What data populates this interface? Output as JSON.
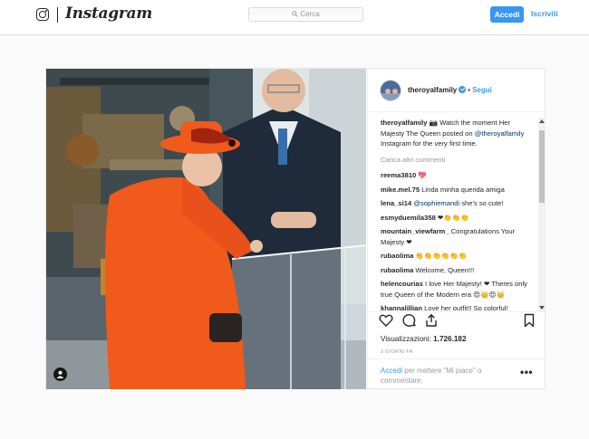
{
  "header": {
    "logo_icon": "instagram-camera-icon",
    "wordmark": "Instagram",
    "search_placeholder": "Cerca",
    "login_label": "Accedi",
    "signup_label": "Iscriviti"
  },
  "post": {
    "account": "theroyalfamily",
    "follow_label": "Segui",
    "caption_user": "theroyalfamily",
    "caption_pre": "📷 Watch the moment Her Majesty The Queen posted on ",
    "caption_mention": "@theroyalfamily",
    "caption_post": " Instagram for the very first time.",
    "load_more": "Carica altri commenti",
    "comments": [
      {
        "user": "reema3810",
        "text": "💖"
      },
      {
        "user": "mike.mel.75",
        "text": "Linda minha querida amiga"
      },
      {
        "user": "lena_si14",
        "mention": "@sophiemandi",
        "text": " she's so cute!"
      },
      {
        "user": "esmyduemila358",
        "text": "❤👏👏👏"
      },
      {
        "user": "mountain_viewfarm_",
        "text": "Congratulations Your Majesty ❤"
      },
      {
        "user": "rubaolima",
        "text": "👏👏👏👏👏👏"
      },
      {
        "user": "rubaolima",
        "text": "Welcome, Queen!!!"
      },
      {
        "user": "helencourias",
        "text": "I love Her Majesty! ❤ Theres only true Queen of the Modern era 😍👑😍👑"
      },
      {
        "user": "khannalillian",
        "text": "Love her outfit!! So colorful!"
      }
    ],
    "views_label": "Visualizzazioni:",
    "views_count": "1.726.182",
    "time_ago": "2 GIORNI FA",
    "login_link": "Accedi",
    "login_text": " per mettere \"Mi piace\" o commentare.",
    "more_label": "•••"
  },
  "colors": {
    "accent": "#3897f0",
    "queen_outfit": "#f05a1a"
  }
}
